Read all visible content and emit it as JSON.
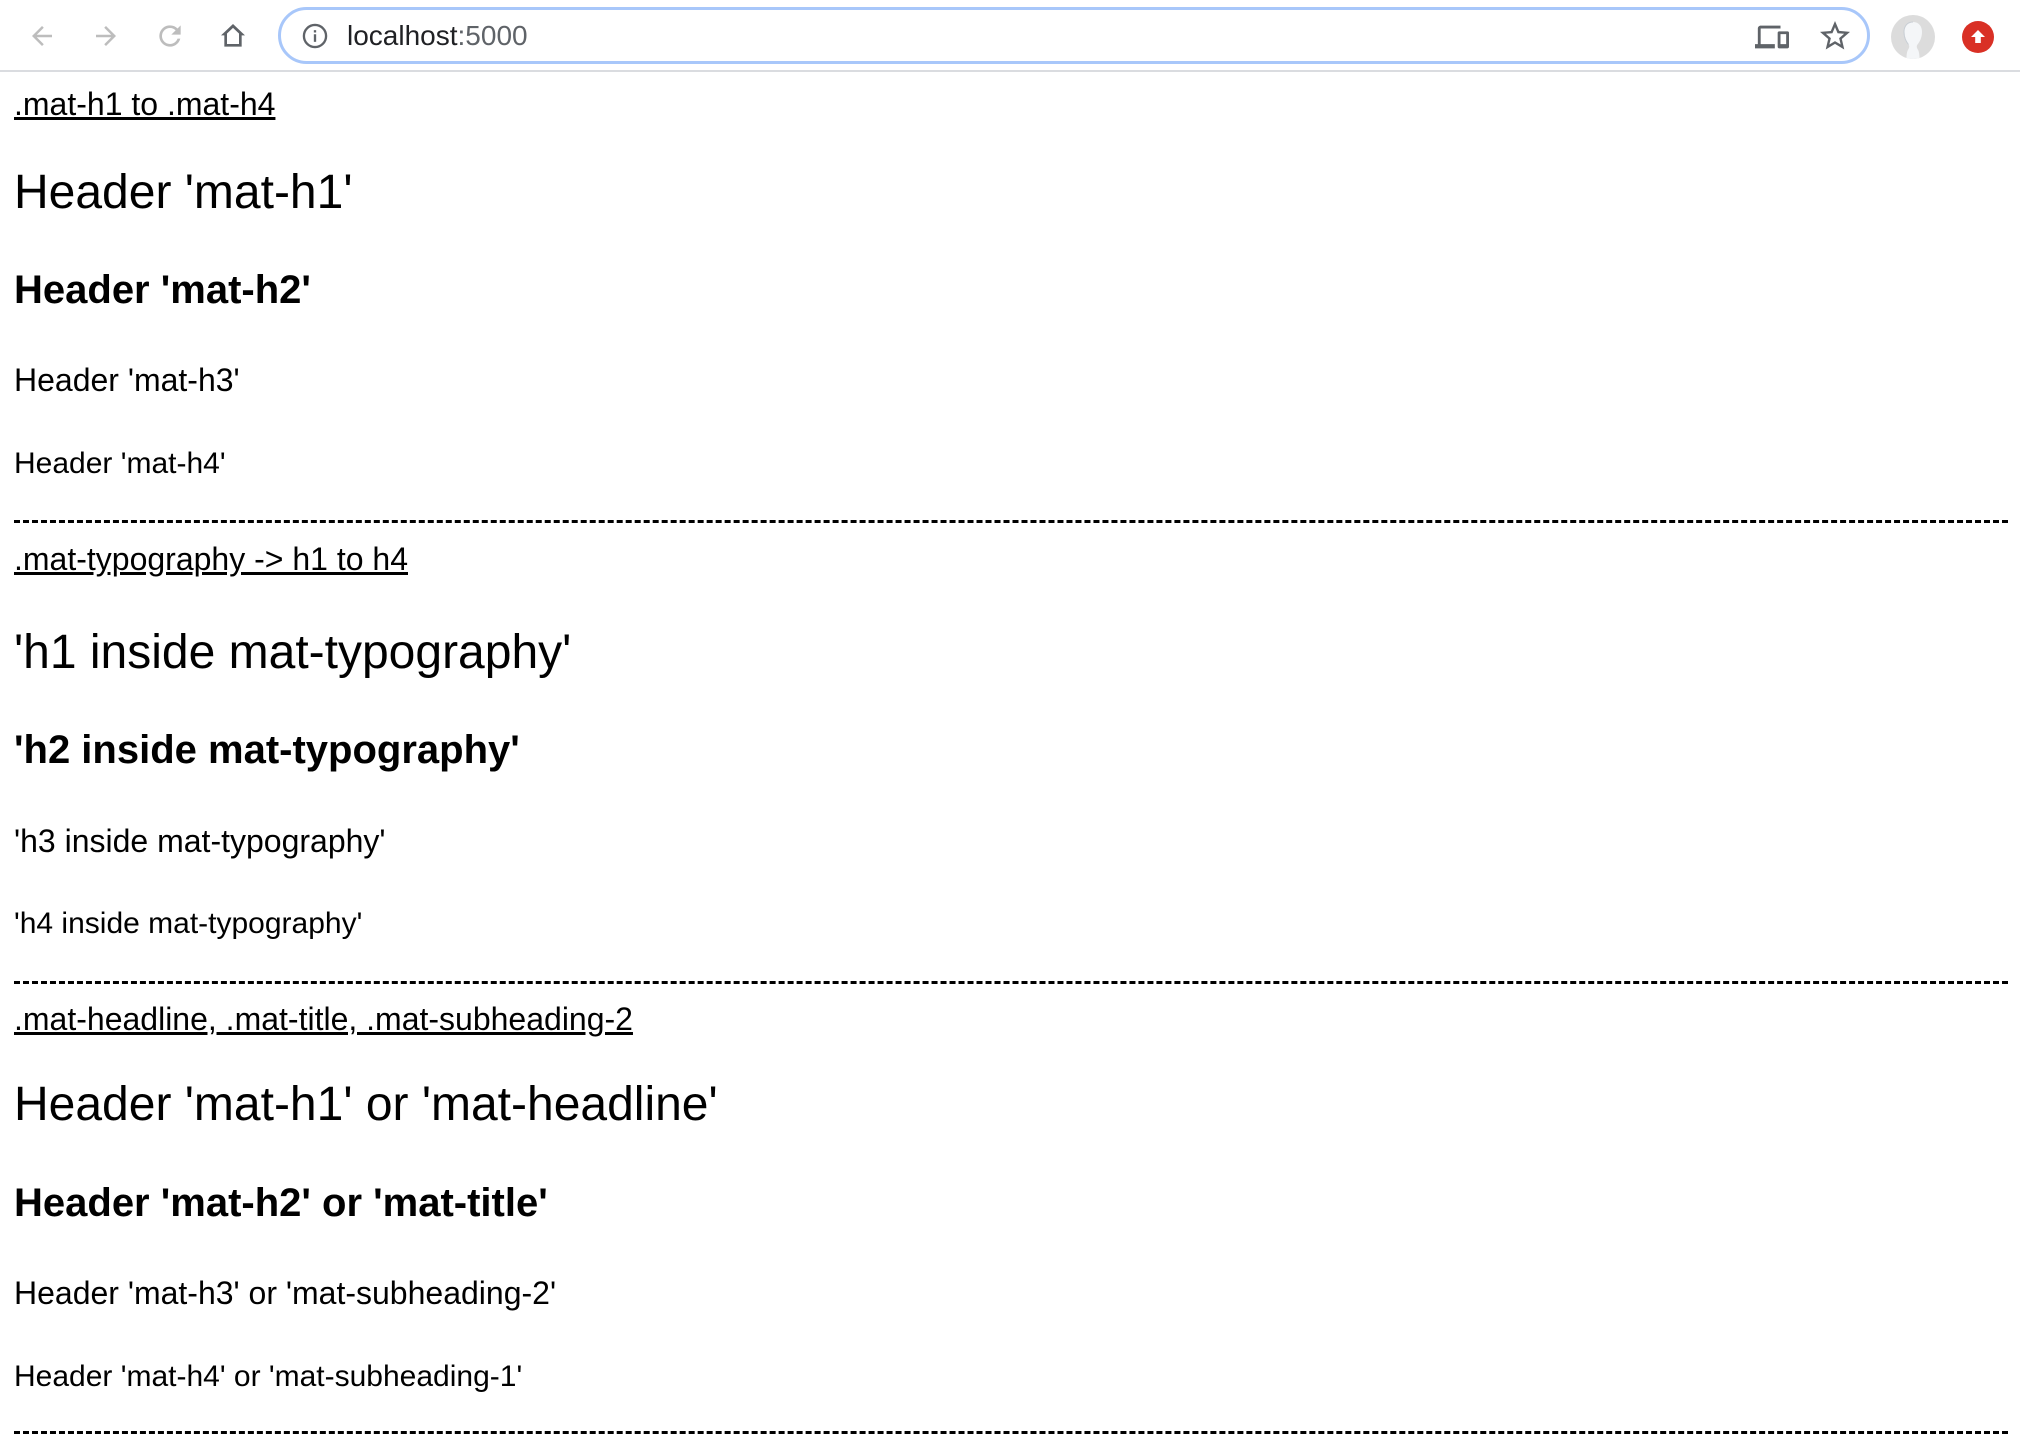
{
  "browser": {
    "url_host": "localhost",
    "url_port": ":5000",
    "icons": {
      "back": "arrow-left",
      "forward": "arrow-right",
      "reload": "reload",
      "home": "home",
      "site_info": "info-circle",
      "devices": "devices",
      "bookmark": "star-outline",
      "profile": "avatar",
      "update": "arrow-up-circle"
    },
    "colors": {
      "omnibox_focus_ring": "#a8c7fa",
      "update_badge": "#d93025",
      "toolbar_border": "#dadce0"
    }
  },
  "sections": [
    {
      "link": ".mat-h1 to .mat-h4",
      "h1": "Header 'mat-h1'",
      "h2": "Header 'mat-h2'",
      "h3": "Header 'mat-h3'",
      "h4": "Header 'mat-h4'"
    },
    {
      "link": ".mat-typography -> h1 to h4",
      "h1": "'h1 inside mat-typography'",
      "h2": "'h2 inside mat-typography'",
      "h3": "'h3 inside mat-typography'",
      "h4": "'h4 inside mat-typography'"
    },
    {
      "link": ".mat-headline, .mat-title, .mat-subheading-2",
      "h1": "Header 'mat-h1' or 'mat-headline'",
      "h2": "Header 'mat-h2' or 'mat-title'",
      "h3": "Header 'mat-h3' or 'mat-subheading-2'",
      "h4": "Header 'mat-h4' or 'mat-subheading-1'"
    }
  ]
}
